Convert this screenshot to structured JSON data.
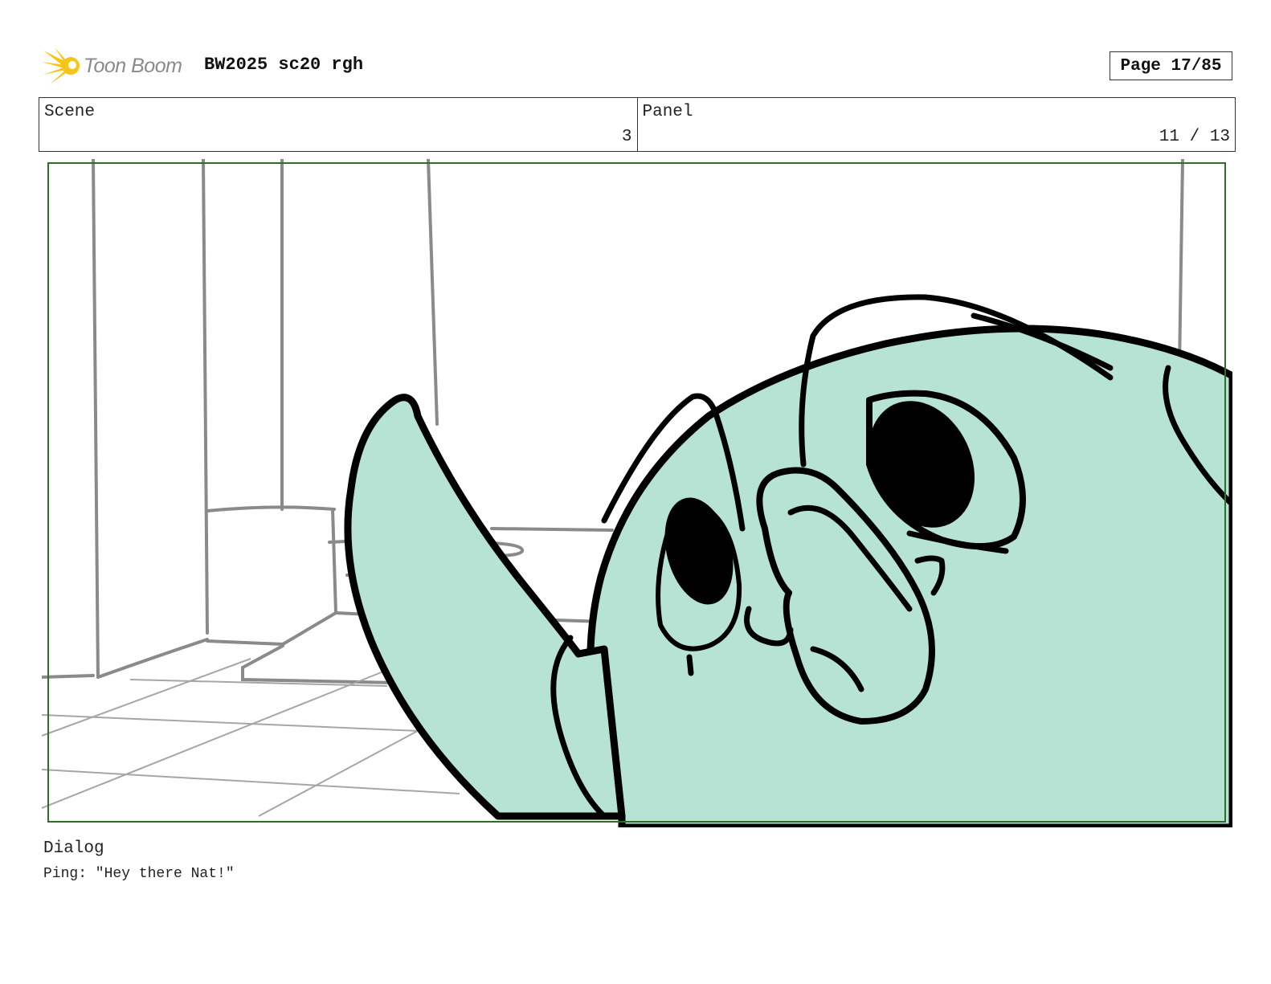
{
  "header": {
    "logo_text": "Toon Boom",
    "doc_title": "BW2025 sc20 rgh",
    "page_label": "Page 17/85"
  },
  "info": {
    "scene_label": "Scene",
    "scene_value": "3",
    "panel_label": "Panel",
    "panel_value": "11 / 13"
  },
  "panel": {
    "character_fill": "#b7e3d5",
    "frame_color": "#2d6e2d"
  },
  "dialog": {
    "label": "Dialog",
    "text": "Ping: \"Hey there Nat!\""
  }
}
